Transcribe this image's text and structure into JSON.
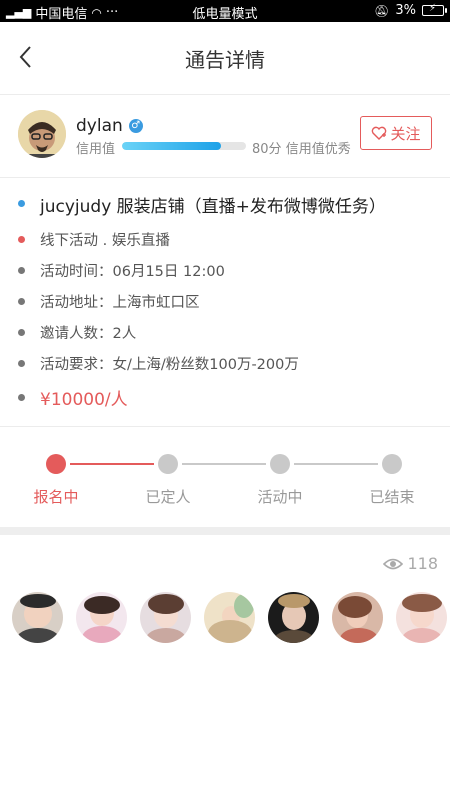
{
  "status_bar": {
    "carrier": "中国电信",
    "center": "低电量模式",
    "battery": "3%"
  },
  "nav": {
    "title": "通告详情"
  },
  "user": {
    "name": "dylan",
    "gender_icon": "male-icon",
    "credit_label": "信用值",
    "credit_progress": 0.8,
    "credit_score": "80分",
    "credit_level": "信用值优秀",
    "follow_label": "关注"
  },
  "notice": {
    "title": "jucyjudy 服装店铺（直播+发布微博微任务）",
    "type": "线下活动 . 娱乐直播",
    "time": "活动时间：06月15日 12:00",
    "location": "活动地址：上海市虹口区",
    "invites": "邀请人数：2人",
    "requirements": "活动要求：女/上海/粉丝数100万-200万",
    "price": "¥10000/人"
  },
  "colors": {
    "accent": "#e45b5b",
    "blue": "#3a9be0",
    "gray": "#c9c9c9"
  },
  "progress": {
    "steps": [
      "报名中",
      "已定人",
      "活动中",
      "已结束"
    ],
    "current": 0
  },
  "applicants": {
    "views": "118",
    "count": 7
  }
}
